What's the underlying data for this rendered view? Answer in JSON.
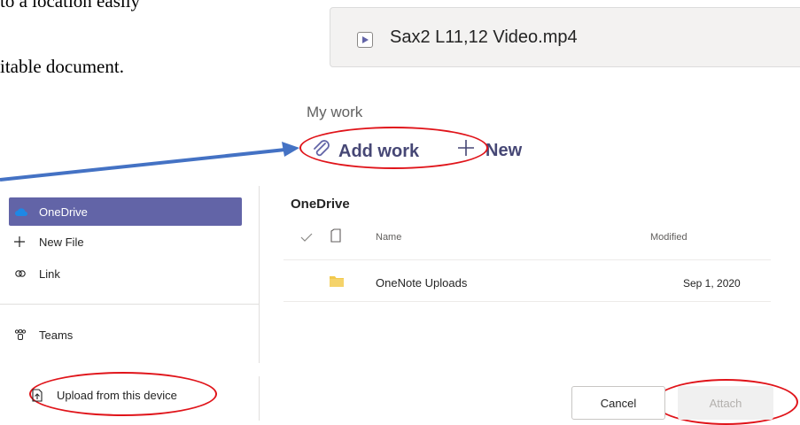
{
  "document": {
    "line1": "to a location easily",
    "line2": "itable document."
  },
  "file": {
    "name": "Sax2 L11,12 Video.mp4",
    "icon": "video-file-icon"
  },
  "mywork": {
    "heading": "My work",
    "add_work_label": "Add work",
    "new_label": "New"
  },
  "picker": {
    "sidebar": {
      "items": [
        {
          "label": "OneDrive",
          "icon": "onedrive-cloud-icon",
          "active": true
        },
        {
          "label": "New File",
          "icon": "plus-icon"
        },
        {
          "label": "Link",
          "icon": "link-icon"
        },
        {
          "label": "Teams",
          "icon": "teams-icon"
        }
      ],
      "upload_label": "Upload from this device"
    },
    "title": "OneDrive",
    "columns": {
      "name": "Name",
      "modified": "Modified"
    },
    "rows": [
      {
        "name": "OneNote Uploads",
        "modified": "Sep 1, 2020",
        "icon": "folder-icon"
      }
    ],
    "cancel_label": "Cancel",
    "attach_label": "Attach"
  },
  "colors": {
    "accent": "#6264a7",
    "annotation_red": "#e0141a",
    "arrow_blue": "#4472c4"
  }
}
